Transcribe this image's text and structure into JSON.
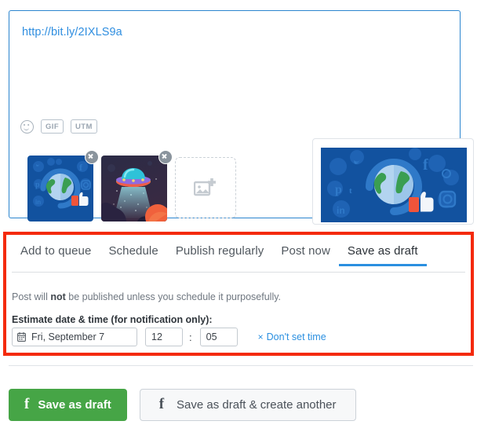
{
  "composer": {
    "link_text": "http://bit.ly/2IXLS9a",
    "tools": [
      {
        "name": "emoji-icon",
        "label": ""
      },
      {
        "name": "gif-button",
        "label": "GIF"
      },
      {
        "name": "utm-button",
        "label": "UTM"
      }
    ],
    "attachments": [
      {
        "name": "social-globe-thumbnail",
        "removable": true
      },
      {
        "name": "ufo-illustration-thumbnail",
        "removable": true
      }
    ],
    "add_media_label": "add-image"
  },
  "schedule": {
    "tabs": [
      {
        "label": "Add to queue",
        "active": false
      },
      {
        "label": "Schedule",
        "active": false
      },
      {
        "label": "Publish regularly",
        "active": false
      },
      {
        "label": "Post now",
        "active": false
      },
      {
        "label": "Save as draft",
        "active": true
      }
    ],
    "note_prefix": "Post will ",
    "note_bold": "not",
    "note_suffix": " be published unless you schedule it purposefully.",
    "estimate_label": "Estimate date & time (for notification only):",
    "date_value": "Fri, September 7",
    "hour_value": "12",
    "time_separator": ":",
    "minute_value": "05",
    "clear_time_x": "×",
    "clear_time_label": "Don't set time"
  },
  "footer": {
    "primary_button": "Save as draft",
    "secondary_button": "Save as draft & create another",
    "facebook_glyph": "f"
  },
  "colors": {
    "accent_blue": "#2a8fe0",
    "highlight_red": "#f42a0c",
    "primary_green": "#46a546",
    "link_blue": "#2f8ee0",
    "border_gray": "#dfe3e8"
  }
}
